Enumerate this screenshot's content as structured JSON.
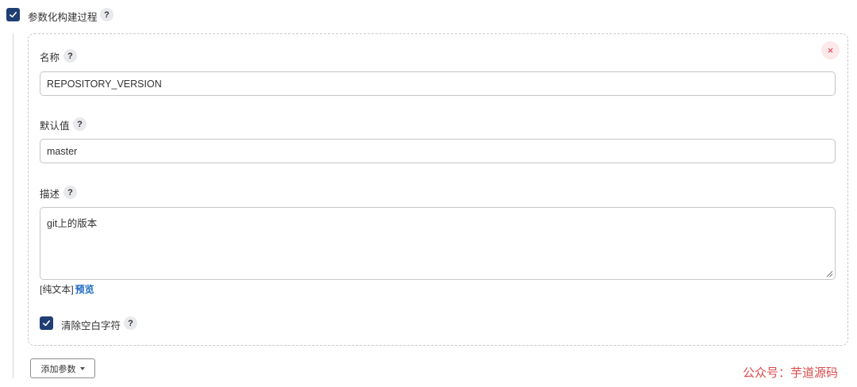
{
  "header": {
    "checkbox_checked": true,
    "label": "参数化构建过程",
    "help": "?"
  },
  "param": {
    "remove_icon": "×",
    "name": {
      "label": "名称",
      "help": "?",
      "value": "REPOSITORY_VERSION"
    },
    "default": {
      "label": "默认值",
      "help": "?",
      "value": "master"
    },
    "description": {
      "label": "描述",
      "help": "?",
      "value": "git上的版本"
    },
    "format": {
      "plain_label": "[纯文本]",
      "preview_label": "预览"
    },
    "trim": {
      "checked": true,
      "label": "清除空白字符",
      "help": "?"
    }
  },
  "add_button": {
    "label": "添加参数"
  },
  "watermark": "公众号：芋道源码",
  "colors": {
    "checkbox": "#1f3e73",
    "link": "#1c69c4",
    "remove": "#d9333f",
    "watermark": "#d94b4b"
  }
}
